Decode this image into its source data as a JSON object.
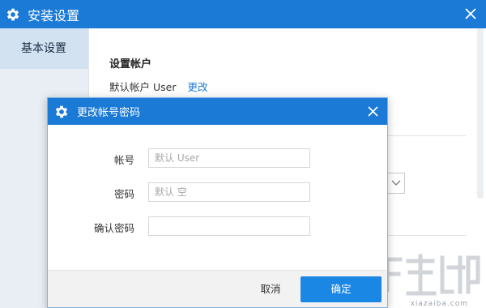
{
  "colors": {
    "accent": "#1a7ad6",
    "sidebar_bg": "#e8eef4",
    "sidebar_active": "#d2e2f1",
    "link": "#1a7ad6",
    "ok_button": "#1a87e5"
  },
  "main_window": {
    "title": "安装设置",
    "icon": "gear-icon",
    "close_icon": "close-icon"
  },
  "sidebar": {
    "items": [
      {
        "label": "基本设置",
        "active": true
      }
    ]
  },
  "content": {
    "section_title": "设置帐户",
    "account_label": "默认帐户",
    "account_value": "User",
    "change_link": "更改"
  },
  "dialog": {
    "title": "更改帐号密码",
    "icon": "gear-icon",
    "close_icon": "close-icon",
    "fields": {
      "account": {
        "label": "帐号",
        "placeholder": "默认 User",
        "value": ""
      },
      "password": {
        "label": "密码",
        "placeholder": "默认 空",
        "value": ""
      },
      "confirm": {
        "label": "确认密码",
        "placeholder": "",
        "value": ""
      }
    },
    "cancel_label": "取消",
    "ok_label": "确定"
  },
  "watermark": {
    "text": "xiazaiba.com"
  }
}
